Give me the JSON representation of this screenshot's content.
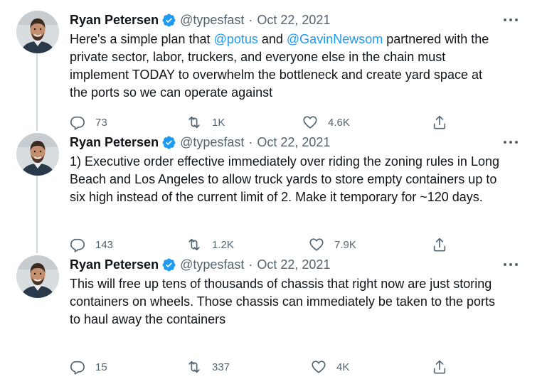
{
  "tweets": [
    {
      "author": {
        "name": "Ryan Petersen",
        "handle": "@typesfast"
      },
      "time": "Oct 22, 2021",
      "text": {
        "line1a": "Here's a simple plan that ",
        "m1": "@potus",
        "line1b": " and ",
        "m2": "@GavinNewsom",
        "line1c": " partnered with the",
        "line2": "private sector, labor, truckers, and everyone else in the chain must",
        "line3": "implement TODAY to overwhelm the bottleneck and create yard space at",
        "line4": "the ports so we can operate against"
      },
      "replies": "73",
      "retweets": "1K",
      "likes": "4.6K"
    },
    {
      "author": {
        "name": "Ryan Petersen",
        "handle": "@typesfast"
      },
      "time": "Oct 22, 2021",
      "text": {
        "line1": "1) Executive order effective immediately over riding the zoning rules in Long",
        "line2": "Beach and Los Angeles to allow truck yards to store empty containers up to",
        "line3": "six high instead of the current limit of 2. Make it temporary for ~120 days."
      },
      "replies": "143",
      "retweets": "1.2K",
      "likes": "7.9K"
    },
    {
      "author": {
        "name": "Ryan Petersen",
        "handle": "@typesfast"
      },
      "time": "Oct 22, 2021",
      "text": {
        "line1": "This will free up tens of thousands of chassis that right now are just storing",
        "line2": "containers on wheels. Those chassis can immediately be taken to the ports",
        "line3": "to haul away the containers"
      },
      "replies": "15",
      "retweets": "337",
      "likes": "4K"
    }
  ],
  "colors": {
    "accent": "#1d9bf0",
    "secondary_text": "#536471",
    "thread_line": "#cfd9de"
  },
  "icons": [
    "verified-badge-icon",
    "more-icon",
    "reply-icon",
    "retweet-icon",
    "like-icon",
    "share-icon"
  ]
}
